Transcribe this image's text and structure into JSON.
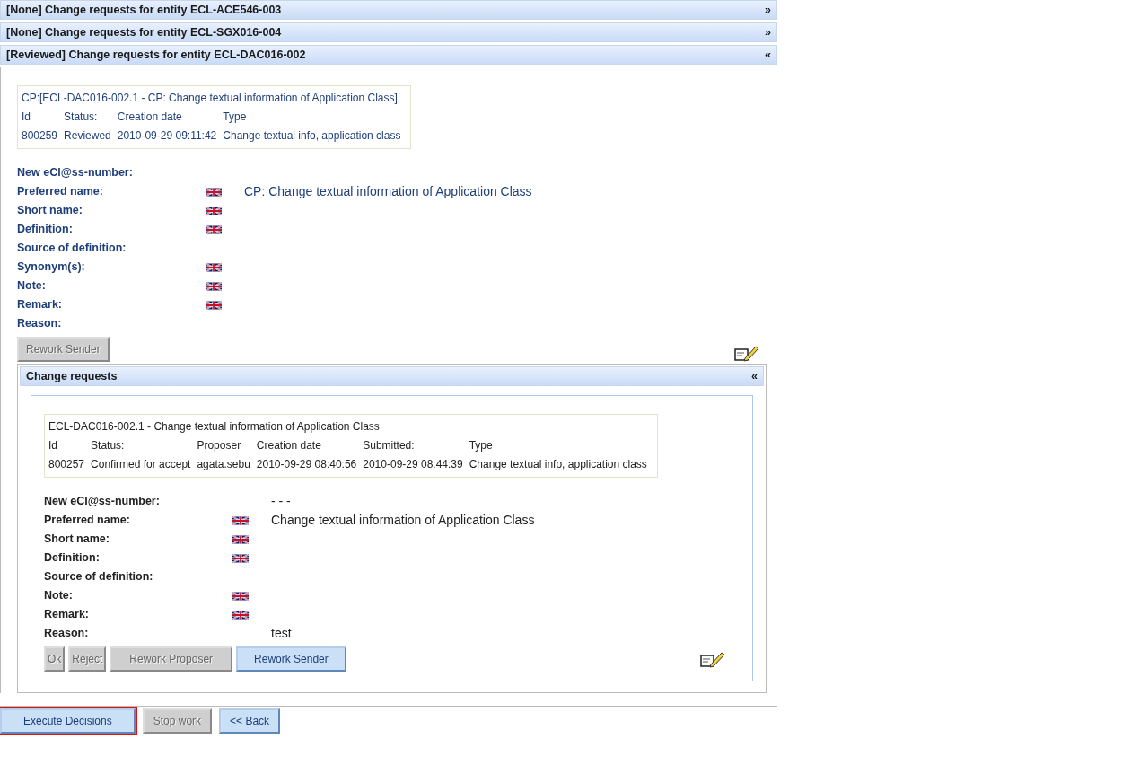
{
  "entities": [
    {
      "title": "[None] Change requests for entity ECL-ACE546-003",
      "toggle": "»"
    },
    {
      "title": "[None] Change requests for entity ECL-SGX016-004",
      "toggle": "»"
    },
    {
      "title": "[Reviewed] Change requests for entity ECL-DAC016-002",
      "toggle": "«",
      "detail": {
        "summary": {
          "title": "CP:[ECL-DAC016-002.1 - CP: Change textual information of Application Class]",
          "columns": [
            "Id",
            "Status:",
            "Creation date",
            "Type"
          ],
          "values": [
            "800259",
            "Reviewed",
            "2010-09-29 09:11:42",
            "Change textual info, application class"
          ]
        },
        "fields": [
          {
            "label": "New eCl@ss-number:",
            "flag": false
          },
          {
            "label": "Preferred name:",
            "flag": true,
            "value": "CP: Change textual information of Application Class"
          },
          {
            "label": "Short name:",
            "flag": true
          },
          {
            "label": "Definition:",
            "flag": true
          },
          {
            "label": "Source of definition:",
            "flag": false
          },
          {
            "label": "Synonym(s):",
            "flag": true
          },
          {
            "label": "Note:",
            "flag": true
          },
          {
            "label": "Remark:",
            "flag": true
          },
          {
            "label": "Reason:",
            "flag": false
          }
        ],
        "buttons": [
          {
            "label": "Rework Sender",
            "disabled": true
          }
        ],
        "change_requests": {
          "title": "Change requests",
          "toggle": "«",
          "summary": {
            "title": "ECL-DAC016-002.1 - Change textual information of Application Class",
            "columns": [
              "Id",
              "Status:",
              "Proposer",
              "Creation date",
              "Submitted:",
              "Type"
            ],
            "values": [
              "800257",
              "Confirmed for accept",
              "agata.sebu",
              "2010-09-29 08:40:56",
              "2010-09-29 08:44:39",
              "Change textual info, application class"
            ]
          },
          "fields": [
            {
              "label": "New eCl@ss-number:",
              "flag": false,
              "value": "- - -"
            },
            {
              "label": "Preferred name:",
              "flag": true,
              "value": "Change textual information of Application Class"
            },
            {
              "label": "Short name:",
              "flag": true
            },
            {
              "label": "Definition:",
              "flag": true
            },
            {
              "label": "Source of definition:",
              "flag": false
            },
            {
              "label": "Note:",
              "flag": true
            },
            {
              "label": "Remark:",
              "flag": true
            },
            {
              "label": "Reason:",
              "flag": false,
              "value": "test"
            }
          ],
          "buttons": [
            {
              "label": "Ok",
              "disabled": true
            },
            {
              "label": "Reject",
              "disabled": true
            },
            {
              "label": "Rework Proposer",
              "disabled": true
            },
            {
              "label": "Rework Sender",
              "disabled": false
            }
          ]
        }
      }
    }
  ],
  "footer_buttons": [
    {
      "label": "Execute Decisions",
      "disabled": false,
      "focused": true
    },
    {
      "label": "Stop work",
      "disabled": true,
      "focused": false
    },
    {
      "label": "<< Back",
      "disabled": false,
      "focused": false
    }
  ]
}
